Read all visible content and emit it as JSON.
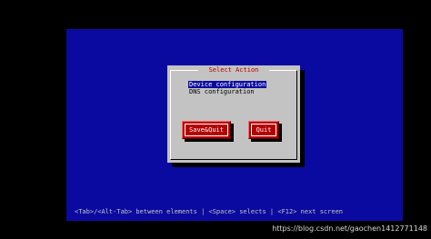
{
  "dialog": {
    "title": "Select Action",
    "menu_items": [
      {
        "label": "Device configuration",
        "selected": true
      },
      {
        "label": "DNS configuration",
        "selected": false
      }
    ],
    "buttons": {
      "save_quit": "Save&Quit",
      "quit": "Quit"
    }
  },
  "statusbar": {
    "text": "<Tab>/<Alt-Tab> between elements   |  <Space> selects   |  <F12> next screen"
  },
  "watermark": {
    "text": "https://blog.csdn.net/gaochen1412771148"
  },
  "colors": {
    "screen_background": "#000000",
    "tui_background": "#0a0aa0",
    "dialog_background": "#c3c3c3",
    "title_text": "#b40000",
    "button_background": "#b40000",
    "selection_background": "#0a0aa0"
  }
}
